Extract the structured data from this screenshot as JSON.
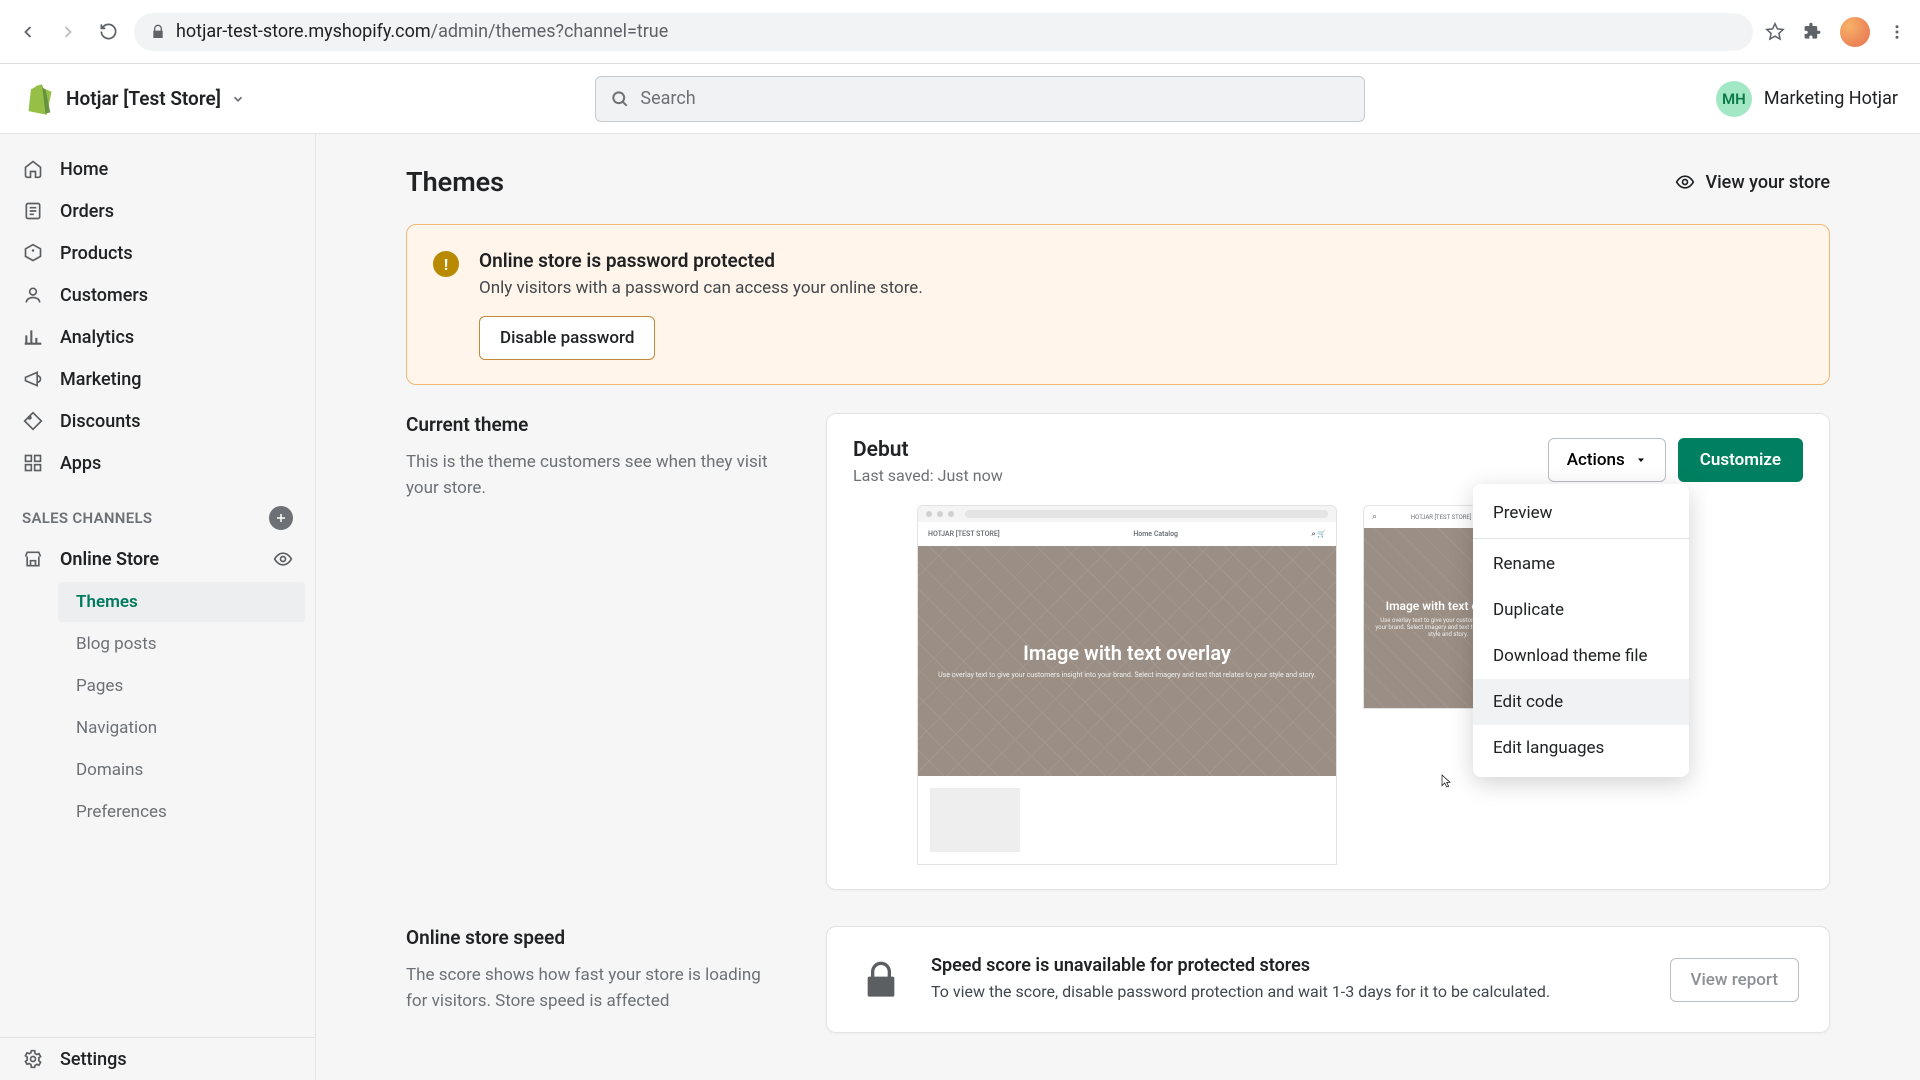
{
  "browser": {
    "url_host": "hotjar-test-store.myshopify.com",
    "url_path": "/admin/themes?channel=true"
  },
  "header": {
    "store_name": "Hotjar [Test Store]",
    "search_placeholder": "Search",
    "user_initials": "MH",
    "user_name": "Marketing Hotjar"
  },
  "sidebar": {
    "items": [
      {
        "label": "Home"
      },
      {
        "label": "Orders"
      },
      {
        "label": "Products"
      },
      {
        "label": "Customers"
      },
      {
        "label": "Analytics"
      },
      {
        "label": "Marketing"
      },
      {
        "label": "Discounts"
      },
      {
        "label": "Apps"
      }
    ],
    "section_label": "SALES CHANNELS",
    "online_store": "Online Store",
    "sub": [
      {
        "label": "Themes",
        "active": true
      },
      {
        "label": "Blog posts"
      },
      {
        "label": "Pages"
      },
      {
        "label": "Navigation"
      },
      {
        "label": "Domains"
      },
      {
        "label": "Preferences"
      }
    ],
    "settings": "Settings"
  },
  "page": {
    "title": "Themes",
    "view_store": "View your store"
  },
  "banner": {
    "title": "Online store is password protected",
    "body": "Only visitors with a password can access your online store.",
    "button": "Disable password"
  },
  "current_theme": {
    "heading": "Current theme",
    "desc": "This is the theme customers see when they visit your store.",
    "name": "Debut",
    "saved": "Last saved: Just now",
    "actions_label": "Actions",
    "customize_label": "Customize",
    "menu": [
      "Preview",
      "Rename",
      "Duplicate",
      "Download theme file",
      "Edit code",
      "Edit languages"
    ],
    "mock_brand": "HOTJAR [TEST STORE]",
    "mock_nav": "Home   Catalog",
    "mock_hero_title": "Image with text overlay",
    "mock_hero_sub": "Use overlay text to give your customers insight into your brand. Select imagery and text that relates to your style and story.",
    "mock_mobile_title": "Image with text overlay",
    "mock_mobile_sub": "Use overlay text to give your customers insight into your brand. Select imagery and text that relates to your style and story."
  },
  "speed": {
    "heading": "Online store speed",
    "desc": "The score shows how fast your store is loading for visitors. Store speed is affected",
    "card_title": "Speed score is unavailable for protected stores",
    "card_body": "To view the score, disable password protection and wait 1-3 days for it to be calculated.",
    "button": "View report"
  }
}
